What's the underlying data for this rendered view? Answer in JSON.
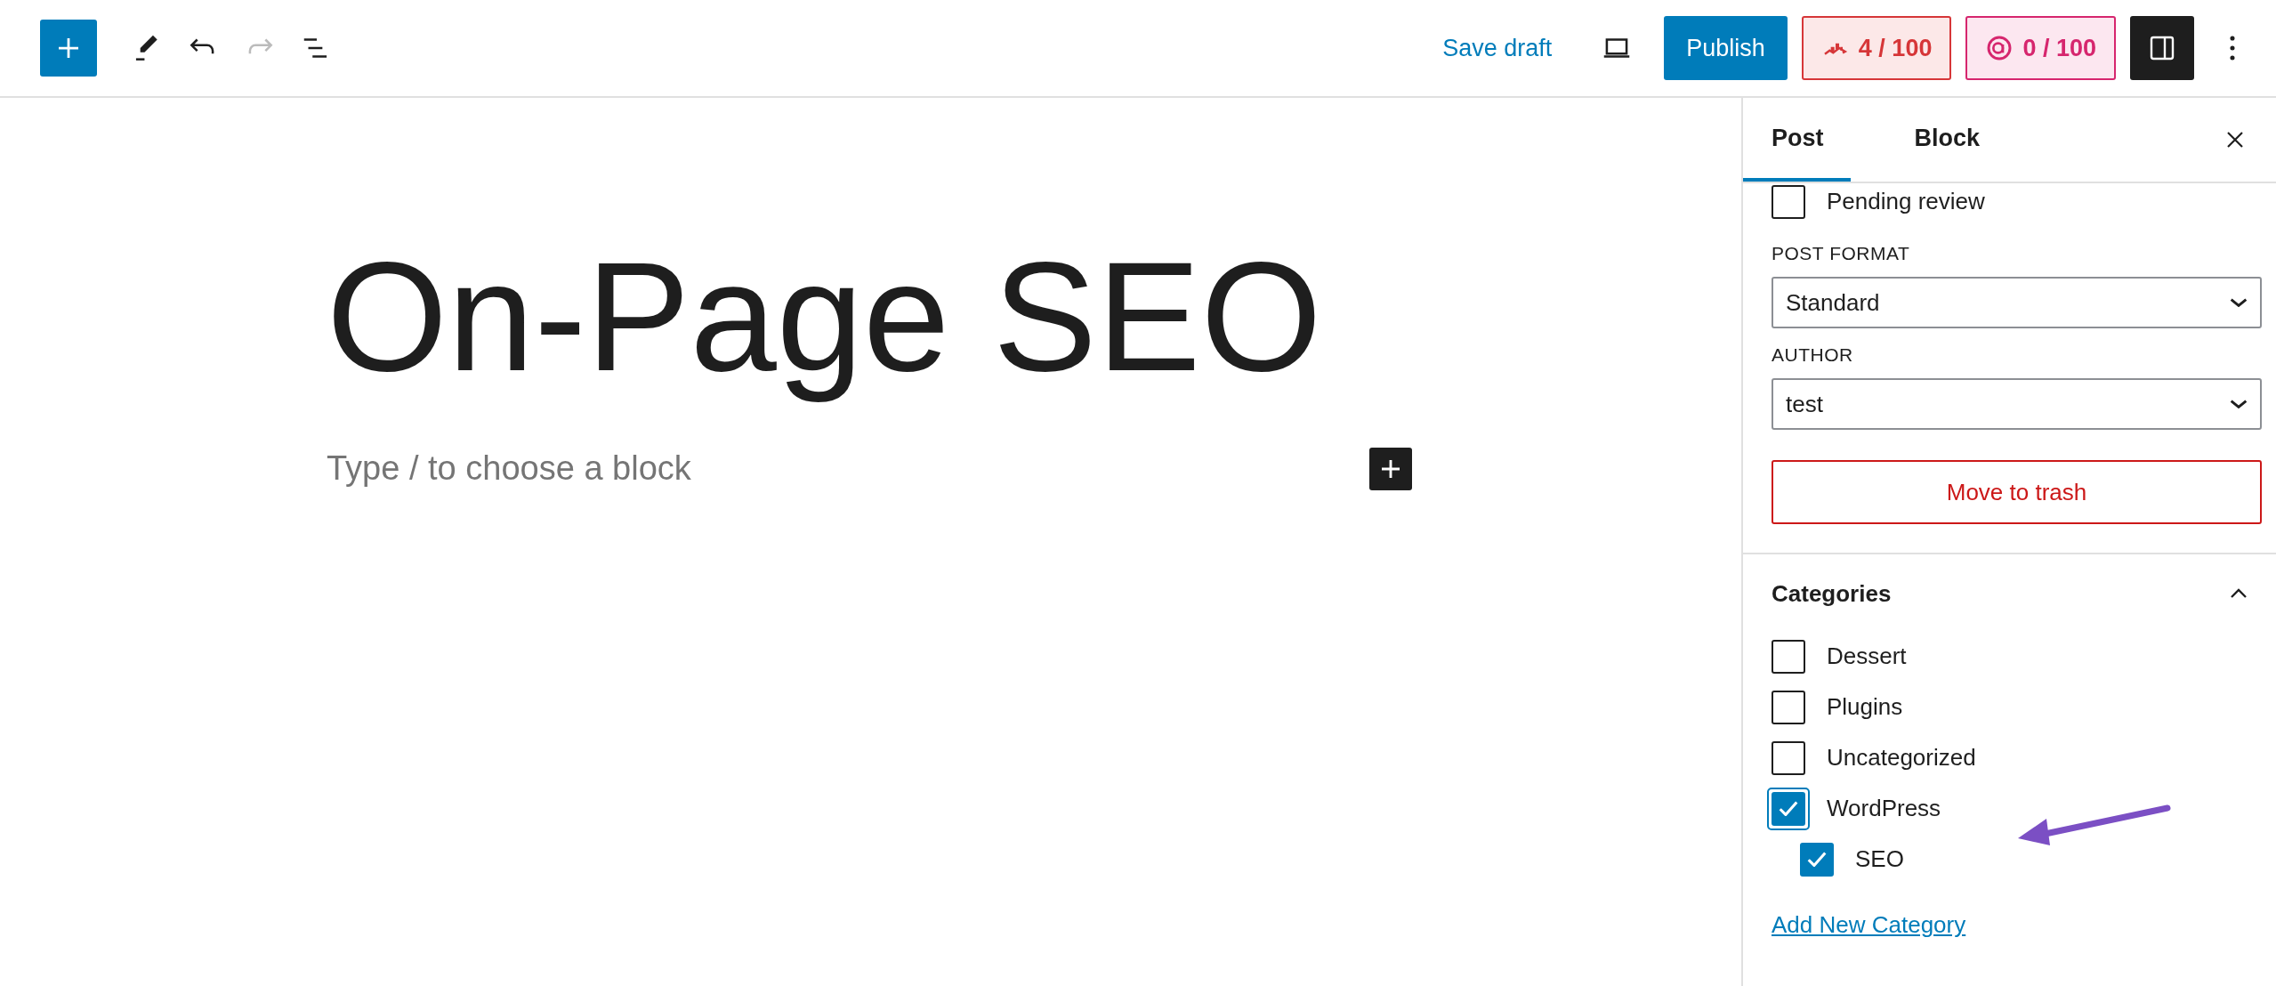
{
  "toolbar": {
    "tools": [
      {
        "kind": "inserter",
        "disabled": false
      },
      {
        "kind": "tools",
        "disabled": false
      },
      {
        "kind": "undo",
        "disabled": false
      },
      {
        "kind": "redo",
        "disabled": true
      },
      {
        "kind": "list_view",
        "disabled": false
      }
    ],
    "save_draft": "Save draft",
    "publish": "Publish",
    "scores": [
      {
        "kind": "seo",
        "value": "4 / 100"
      },
      {
        "kind": "ai",
        "value": "0 / 100"
      }
    ],
    "sidebar_toggle": {
      "on": true
    }
  },
  "editor": {
    "title": "On-Page SEO",
    "placeholder": "Type / to choose a block"
  },
  "sidebar": {
    "tabs": [
      {
        "label": "Post",
        "selected": true
      },
      {
        "label": "Block",
        "selected": false
      }
    ],
    "pending_review": {
      "label": "Pending review",
      "checked": false
    },
    "post_format": {
      "label": "POST FORMAT",
      "value": "Standard"
    },
    "author": {
      "label": "AUTHOR",
      "value": "test"
    },
    "trash": "Move to trash",
    "categories": {
      "title": "Categories",
      "expanded": true,
      "items": [
        {
          "label": "Dessert",
          "checked": false,
          "focused": false
        },
        {
          "label": "Plugins",
          "checked": false,
          "focused": false
        },
        {
          "label": "Uncategorized",
          "checked": false,
          "focused": false
        },
        {
          "label": "WordPress",
          "checked": true,
          "focused": true,
          "children": [
            {
              "label": "SEO",
              "checked": true,
              "focused": false
            }
          ]
        }
      ],
      "add_link": "Add New Category"
    }
  }
}
